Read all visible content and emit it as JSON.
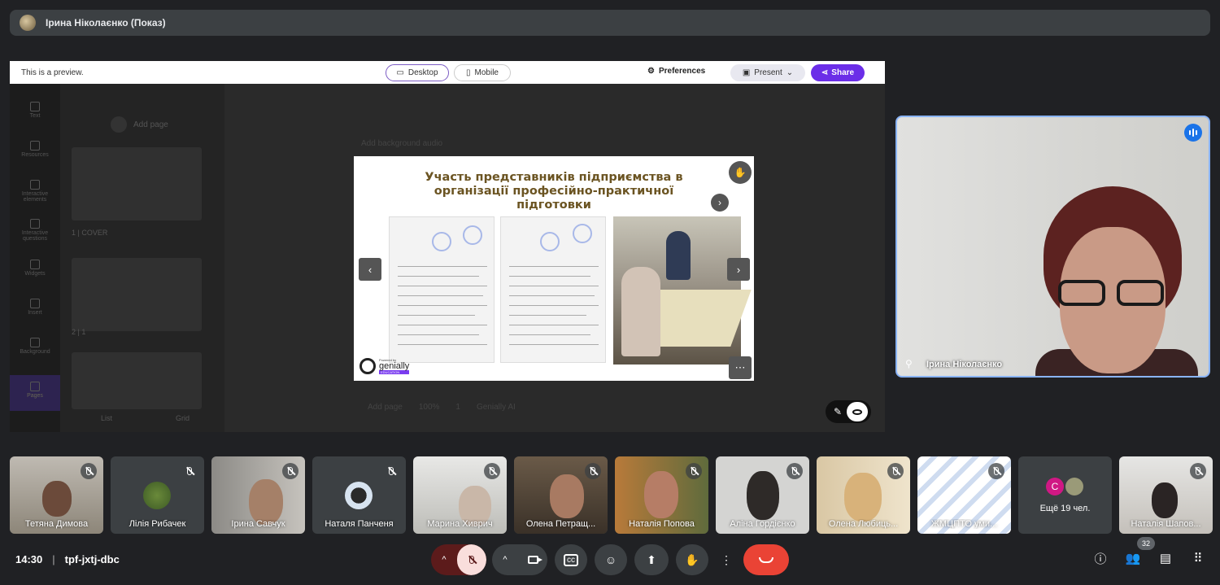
{
  "presenter": {
    "name": "Ірина Ніколаєнко (Показ)"
  },
  "preview_bar": {
    "notice": "This is a preview.",
    "desktop_label": "Desktop",
    "mobile_label": "Mobile",
    "preferences_label": "Preferences",
    "present_label": "Present",
    "share_label": "Share"
  },
  "editor": {
    "tools": [
      "Text",
      "Resources",
      "Interactive elements",
      "Interactive questions",
      "Widgets",
      "Insert",
      "Background",
      "Pages"
    ],
    "add_page_label": "Add page",
    "add_background_audio": "Add background audio",
    "pages": [
      "1 | COVER",
      "2 | 1"
    ],
    "view_list": "List",
    "view_grid": "Grid",
    "bottom_add_page": "Add page",
    "zoom": "100%",
    "page_number": "1",
    "ai_label": "Genially AI"
  },
  "slide": {
    "title": "Участь представників підприємства в організації професійно-практичної підготовки",
    "brand_powered": "Powered by",
    "brand_name": "genially",
    "brand_edu": "EDUCATION"
  },
  "self_view": {
    "name": "Ірина Ніколаєнко"
  },
  "participants": [
    {
      "name": "Тетяна Димова"
    },
    {
      "name": "Лілія Рибачек"
    },
    {
      "name": "Ірина Савчук"
    },
    {
      "name": "Наталя Панченя"
    },
    {
      "name": "Марина Хиврич"
    },
    {
      "name": "Олена Петращ..."
    },
    {
      "name": "Наталія Попова"
    },
    {
      "name": "Аліна Гордієнко"
    },
    {
      "name": "Олена Любиць..."
    },
    {
      "name": "ЖМЦПТО уми..."
    },
    {
      "name": "Ещё 19 чел.",
      "initial": "С"
    },
    {
      "name": "Наталія Шапов..."
    }
  ],
  "bottom_bar": {
    "time": "14:30",
    "meeting_code": "tpf-jxtj-dbc",
    "people_count": "32"
  },
  "colors": {
    "background": "#202124",
    "tile": "#3c4043",
    "end_call": "#ea4335",
    "share": "#6b2ee8",
    "active_speaker_border": "#8ab4f8"
  }
}
